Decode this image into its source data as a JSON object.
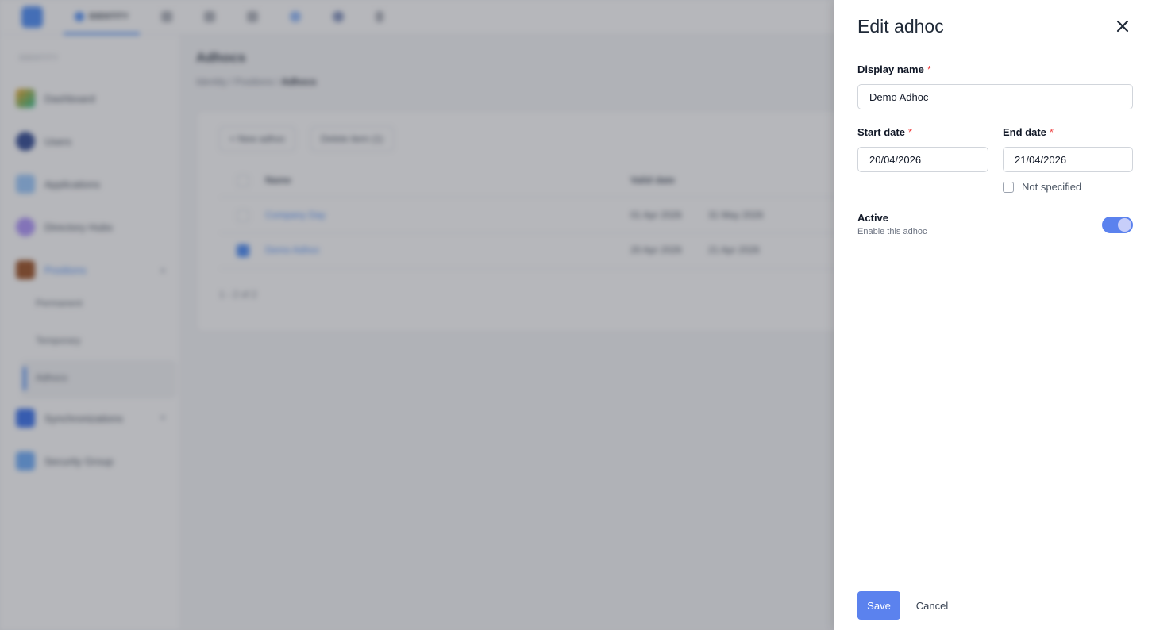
{
  "app": {
    "top_tab_active_label": "IDENTITY",
    "sidebar_section": "IDENTITY",
    "sidebar": {
      "items": [
        {
          "label": "Dashboard",
          "icon": "dashboard-icon"
        },
        {
          "label": "Users",
          "icon": "user-icon"
        },
        {
          "label": "Applications",
          "icon": "applications-icon"
        },
        {
          "label": "Directory Hubs",
          "icon": "directory-icon"
        },
        {
          "label": "Positions",
          "icon": "briefcase-icon"
        },
        {
          "label": "Synchronizations",
          "icon": "sync-icon"
        },
        {
          "label": "Security Group",
          "icon": "shield-icon"
        }
      ],
      "sub_items": [
        {
          "label": "Permanent"
        },
        {
          "label": "Temporary"
        },
        {
          "label": "Adhocs"
        }
      ]
    },
    "page_title": "Adhocs",
    "breadcrumb": [
      "Identity",
      "Positions",
      "Adhocs"
    ],
    "toolbar": {
      "new_label": "+ New adhoc",
      "delete_label": "Delete item (1)"
    },
    "table": {
      "columns": [
        "Name",
        "Valid date"
      ],
      "rows": [
        {
          "name": "Company Day",
          "valid_from": "01 Apr 2026",
          "valid_to": "31 May 2026"
        },
        {
          "name": "Demo Adhoc",
          "valid_from": "20 Apr 2026",
          "valid_to": "21 Apr 2026"
        }
      ],
      "pagination": "1 - 2 of 2"
    }
  },
  "drawer": {
    "title": "Edit adhoc",
    "display_name_label": "Display name",
    "display_name_value": "Demo Adhoc",
    "start_date_label": "Start date",
    "start_date_value": "20/04/2026",
    "end_date_label": "End date",
    "end_date_value": "21/04/2026",
    "not_specified_label": "Not specified",
    "active_label": "Active",
    "active_sub": "Enable this adhoc",
    "required_mark": "*",
    "save_label": "Save",
    "cancel_label": "Cancel",
    "colors": {
      "accent": "#5b82ee",
      "required": "#ef4444"
    }
  }
}
